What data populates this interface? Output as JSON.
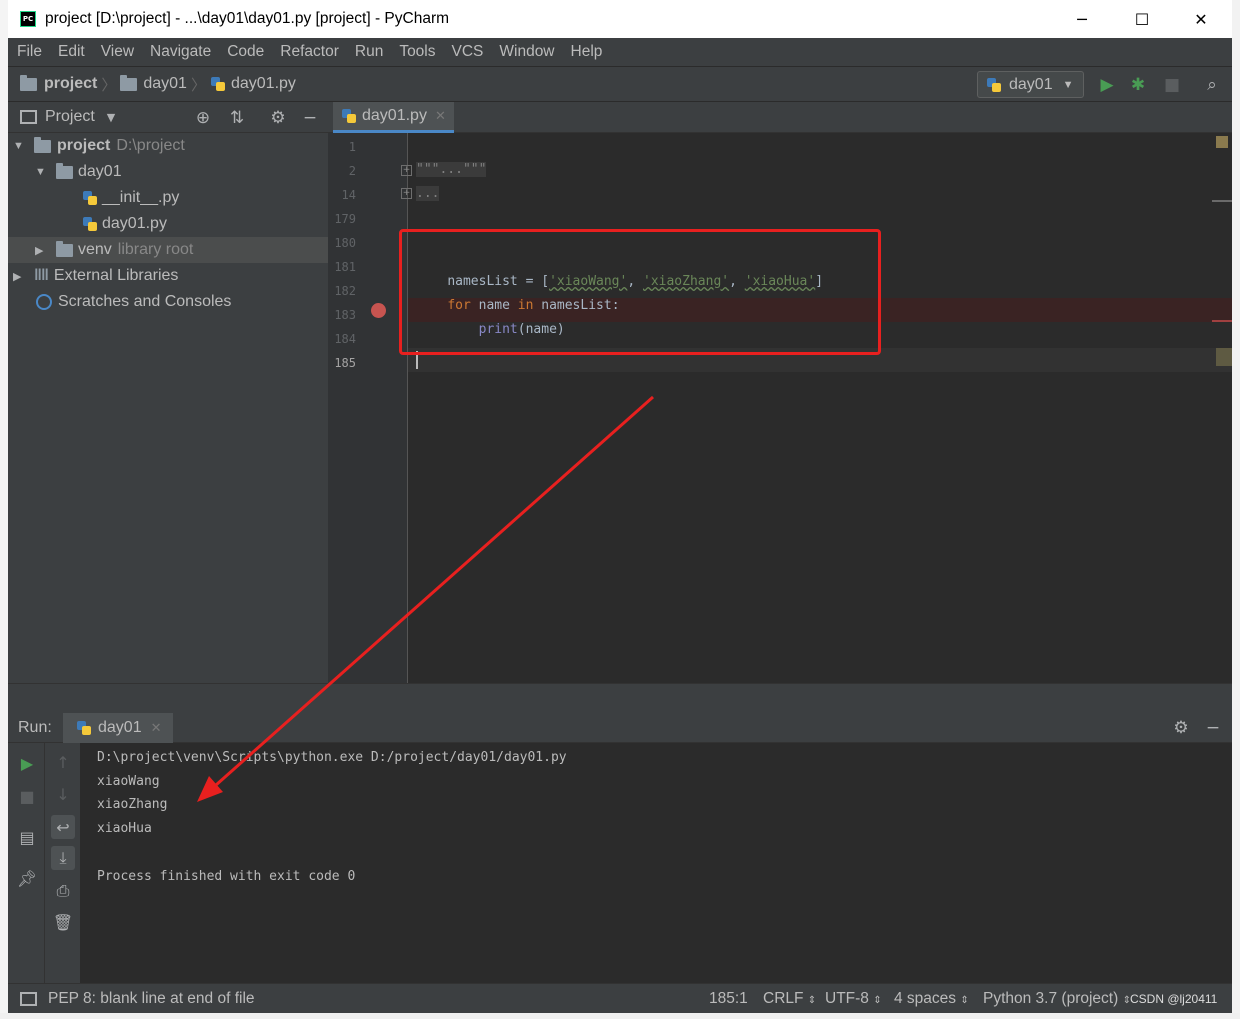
{
  "window": {
    "title": "project [D:\\project] - ...\\day01\\day01.py [project] - PyCharm",
    "app_icon": "PC",
    "controls": [
      "─",
      "☐",
      "✕"
    ]
  },
  "menu": [
    "File",
    "Edit",
    "View",
    "Navigate",
    "Code",
    "Refactor",
    "Run",
    "Tools",
    "VCS",
    "Window",
    "Help"
  ],
  "breadcrumb": {
    "root": "project",
    "folder": "day01",
    "file": "day01.py"
  },
  "toolbar": {
    "run_config": "day01"
  },
  "project_panel": {
    "title": "Project",
    "root_name": "project",
    "root_path": "D:\\project",
    "folder": "day01",
    "files": [
      "__init__.py",
      "day01.py"
    ],
    "venv": "venv",
    "venv_note": "library root",
    "external": "External Libraries",
    "scratches": "Scratches and Consoles"
  },
  "editor": {
    "tab": "day01.py",
    "line_numbers": [
      "1",
      "2",
      "14",
      "179",
      "180",
      "181",
      "182",
      "183",
      "184",
      "185"
    ],
    "fold1": "\"\"\"...\"\"\"",
    "fold2": "...",
    "code": {
      "l181_var": "namesList = [",
      "l181_s1": "'xiaoWang'",
      "l181_s2": "'xiaoZhang'",
      "l181_s3": "'xiaoHua'",
      "l182_for": "for",
      "l182_name": " name ",
      "l182_in": "in",
      "l182_rest": " namesList:",
      "l183_indent": "    ",
      "l183_fn": "print",
      "l183_arg": "(name)"
    }
  },
  "run_panel": {
    "label": "Run:",
    "tab": "day01",
    "output": [
      "D:\\project\\venv\\Scripts\\python.exe D:/project/day01/day01.py",
      "xiaoWang",
      "xiaoZhang",
      "xiaoHua",
      "",
      "Process finished with exit code 0"
    ]
  },
  "status_bar": {
    "message": "PEP 8: blank line at end of file",
    "position": "185:1",
    "line_sep": "CRLF",
    "encoding": "UTF-8",
    "indent": "4 spaces",
    "interpreter": "Python 3.7 (project)",
    "watermark": "CSDN @lj20411"
  },
  "colors": {
    "annotation": "#e8201f",
    "keyword": "#cc7832",
    "string": "#6a8759",
    "run_green": "#499c54",
    "breakpoint": "#c75450"
  }
}
